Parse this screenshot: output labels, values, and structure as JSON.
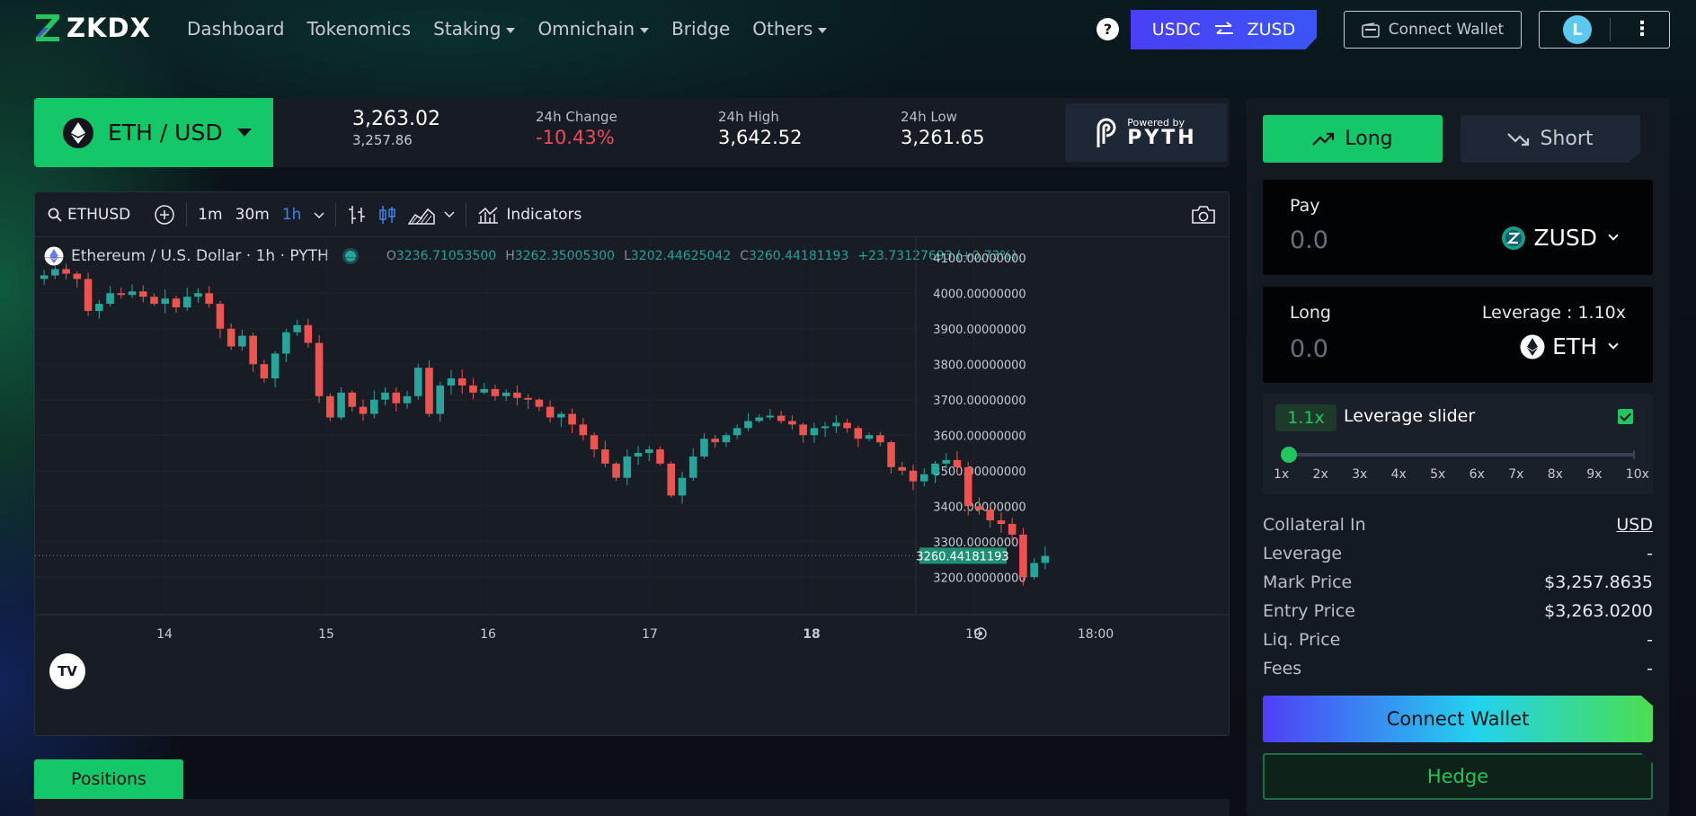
{
  "brand": {
    "name": "ZKDX"
  },
  "nav": {
    "items": [
      {
        "label": "Dashboard",
        "has_menu": false
      },
      {
        "label": "Tokenomics",
        "has_menu": false
      },
      {
        "label": "Staking",
        "has_menu": true
      },
      {
        "label": "Omnichain",
        "has_menu": true
      },
      {
        "label": "Bridge",
        "has_menu": false
      },
      {
        "label": "Others",
        "has_menu": true
      }
    ],
    "help_label": "?",
    "swap": {
      "from": "USDC",
      "to": "ZUSD",
      "icon": "swap-arrows-icon"
    },
    "connect_wallet_label": "Connect Wallet",
    "account_initial": "L"
  },
  "ticker": {
    "pair": "ETH / USD",
    "price": "3,263.02",
    "mark_price": "3,257.86",
    "change_label": "24h Change",
    "change_value": "-10.43%",
    "high_label": "24h High",
    "high_value": "3,642.52",
    "low_label": "24h Low",
    "low_value": "3,261.65",
    "powered_by": "Powered by",
    "oracle": "PYTH"
  },
  "chart_toolbar": {
    "symbol": "ETHUSD",
    "intervals": [
      "1m",
      "30m",
      "1h"
    ],
    "active_interval": "1h",
    "indicators_label": "Indicators"
  },
  "chart_legend": {
    "title": "Ethereum / U.S. Dollar · 1h · PYTH",
    "o_label": "O",
    "o": "3236.71053500",
    "h_label": "H",
    "h": "3262.35005300",
    "l_label": "L",
    "l": "3202.44625042",
    "c_label": "C",
    "c": "3260.44181193",
    "change": "+23.73127693 (+0.73%)"
  },
  "chart_data": {
    "type": "candlestick",
    "ylim": [
      3150,
      4150
    ],
    "y_ticks": [
      "4100.00000000",
      "4000.00000000",
      "3900.00000000",
      "3800.00000000",
      "3700.00000000",
      "3600.00000000",
      "3500.00000000",
      "3400.00000000",
      "3300.00000000",
      "3200.00000000"
    ],
    "x_ticks": [
      "14",
      "15",
      "16",
      "17",
      "18",
      "19",
      "18:00"
    ],
    "last_price_label": "3260.44181193",
    "colors": {
      "up": "#26a69a",
      "down": "#ef5350"
    },
    "close_path": [
      4050,
      4068,
      4055,
      4040,
      3950,
      3970,
      4000,
      3995,
      4005,
      3990,
      3970,
      3985,
      3960,
      3990,
      4000,
      3970,
      3900,
      3850,
      3880,
      3800,
      3760,
      3830,
      3890,
      3910,
      3860,
      3710,
      3650,
      3720,
      3680,
      3660,
      3700,
      3720,
      3690,
      3710,
      3790,
      3660,
      3740,
      3760,
      3740,
      3720,
      3730,
      3710,
      3720,
      3705,
      3700,
      3680,
      3650,
      3660,
      3630,
      3600,
      3560,
      3520,
      3480,
      3540,
      3550,
      3560,
      3520,
      3430,
      3480,
      3540,
      3590,
      3580,
      3600,
      3620,
      3640,
      3650,
      3655,
      3640,
      3630,
      3600,
      3620,
      3625,
      3635,
      3620,
      3590,
      3600,
      3580,
      3510,
      3500,
      3470,
      3490,
      3520,
      3530,
      3510,
      3400,
      3390,
      3360,
      3350,
      3320,
      3200,
      3240,
      3260
    ]
  },
  "positions_tab": "Positions",
  "trade_panel": {
    "long_label": "Long",
    "short_label": "Short",
    "pay_label": "Pay",
    "pay_amount": "0.0",
    "pay_token": "ZUSD",
    "long_box_label": "Long",
    "leverage_display": "Leverage : 1.10x",
    "long_amount": "0.0",
    "long_token": "ETH",
    "leverage_badge": "1.1x",
    "slider_title": "Leverage slider",
    "slider_value": 1.1,
    "slider_ticks": [
      "1x",
      "2x",
      "3x",
      "4x",
      "5x",
      "6x",
      "7x",
      "8x",
      "9x",
      "10x"
    ],
    "rows": [
      {
        "label": "Collateral In",
        "value": "USD"
      },
      {
        "label": "Leverage",
        "value": "-"
      },
      {
        "label": "Mark Price",
        "value": "$3,257.8635"
      },
      {
        "label": "Entry Price",
        "value": "$3,263.0200"
      },
      {
        "label": "Liq. Price",
        "value": "-"
      },
      {
        "label": "Fees",
        "value": "-"
      }
    ],
    "connect_label": "Connect Wallet",
    "hedge_label": "Hedge"
  }
}
